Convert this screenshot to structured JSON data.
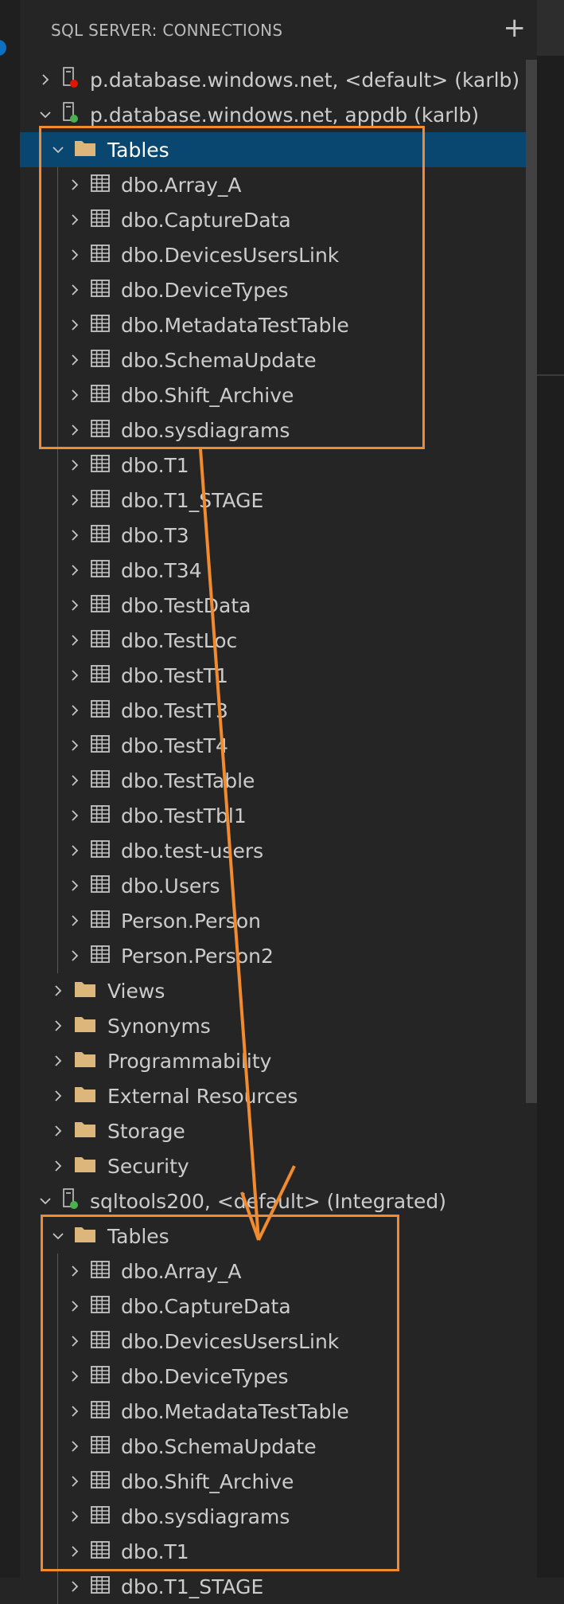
{
  "header": {
    "title": "SQL SERVER: CONNECTIONS",
    "add_symbol": "+"
  },
  "icons": {
    "chevron": "chevron-icon",
    "server": "server-icon",
    "folder": "folder-icon",
    "table": "table-icon"
  },
  "colors": {
    "accent_selection": "#094771",
    "annotation": "#f28a2e",
    "server_disconnected": "#e51400",
    "server_connected": "#4caf50",
    "folder": "#dcb67a"
  },
  "connection1": {
    "label": "p.database.windows.net, <default> (karlb)"
  },
  "connection2": {
    "label": "p.database.windows.net, appdb (karlb)",
    "tables_label": "Tables",
    "tables": [
      "dbo.Array_A",
      "dbo.CaptureData",
      "dbo.DevicesUsersLink",
      "dbo.DeviceTypes",
      "dbo.MetadataTestTable",
      "dbo.SchemaUpdate",
      "dbo.Shift_Archive",
      "dbo.sysdiagrams",
      "dbo.T1",
      "dbo.T1_STAGE",
      "dbo.T3",
      "dbo.T34",
      "dbo.TestData",
      "dbo.TestLoc",
      "dbo.TestT1",
      "dbo.TestT3",
      "dbo.TestT4",
      "dbo.TestTable",
      "dbo.TestTbl1",
      "dbo.test-users",
      "dbo.Users",
      "Person.Person",
      "Person.Person2"
    ],
    "folders": [
      "Views",
      "Synonyms",
      "Programmability",
      "External Resources",
      "Storage",
      "Security"
    ]
  },
  "connection3": {
    "label": "sqltools200, <default> (Integrated)",
    "tables_label": "Tables",
    "tables": [
      "dbo.Array_A",
      "dbo.CaptureData",
      "dbo.DevicesUsersLink",
      "dbo.DeviceTypes",
      "dbo.MetadataTestTable",
      "dbo.SchemaUpdate",
      "dbo.Shift_Archive",
      "dbo.sysdiagrams",
      "dbo.T1",
      "dbo.T1_STAGE"
    ]
  }
}
